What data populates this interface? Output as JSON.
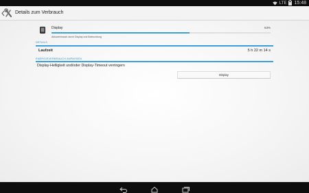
{
  "status_bar": {
    "network_label": "LTE",
    "battery_level": 0.8,
    "time": "15:48"
  },
  "action_bar": {
    "title": "Details zum Verbrauch",
    "up_icon": "settings-up-icon"
  },
  "app_usage": {
    "icon": "display-icon",
    "name": "Display",
    "percent": "63%",
    "percent_value": 63,
    "description": "Akkuverbrauch durch Display und Beleuchtung"
  },
  "details_section": {
    "header": "DETAILS",
    "rows": [
      {
        "label": "Laufzeit",
        "value": "5 h 22 m 14 s"
      }
    ]
  },
  "energy_section": {
    "header": "ENERGIEVERBRAUCH ANPASSEN",
    "tip": "Display-Helligkeit und/oder Display-Timeout verringern",
    "button_label": "Display"
  },
  "nav_bar": {
    "icons": [
      "back-icon",
      "home-icon",
      "recent-apps-icon"
    ]
  },
  "colors": {
    "accent": "#3a9fd6",
    "section_header": "#2f8dc8",
    "bar_background": "#0d0d0d"
  }
}
